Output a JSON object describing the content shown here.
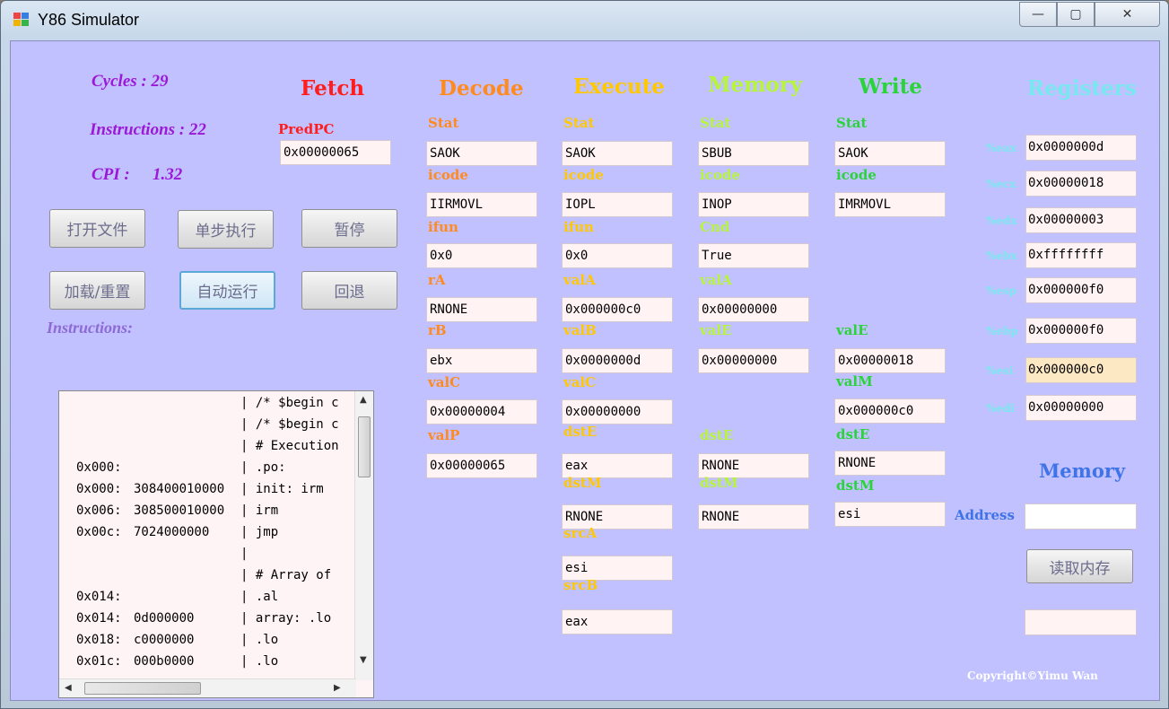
{
  "window": {
    "title": "Y86 Simulator",
    "min_label": "—",
    "max_label": "▢",
    "close_label": "✕"
  },
  "stats": {
    "cycles": "Cycles : 29",
    "instructions": "Instructions : 22",
    "cpi_label": "CPI :",
    "cpi_value": "1.32"
  },
  "buttons": {
    "open_file": "打开文件",
    "step": "单步执行",
    "pause": "暂停",
    "load_reset": "加载/重置",
    "auto_run": "自动运行",
    "rollback": "回退",
    "read_mem": "读取内存"
  },
  "instructions_label": "Instructions:",
  "instructions": [
    {
      "addr": "",
      "code": "",
      "src": "| /* $begin c"
    },
    {
      "addr": "",
      "code": "",
      "src": "| /* $begin c"
    },
    {
      "addr": "",
      "code": "",
      "src": "| # Execution"
    },
    {
      "addr": "0x000:",
      "code": "",
      "src": "|          .po:"
    },
    {
      "addr": "0x000:",
      "code": "308400010000",
      "src": "| init:    irm"
    },
    {
      "addr": "0x006:",
      "code": "308500010000",
      "src": "|          irm"
    },
    {
      "addr": "0x00c:",
      "code": "7024000000",
      "src": "|          jmp"
    },
    {
      "addr": "",
      "code": "",
      "src": "|"
    },
    {
      "addr": "",
      "code": "",
      "src": "| # Array of"
    },
    {
      "addr": "0x014:",
      "code": "",
      "src": "|          .al"
    },
    {
      "addr": "0x014:",
      "code": "0d000000",
      "src": "| array:   .lo"
    },
    {
      "addr": "0x018:",
      "code": "c0000000",
      "src": "|          .lo"
    },
    {
      "addr": "0x01c:",
      "code": "000b0000",
      "src": "|          .lo"
    }
  ],
  "fetch": {
    "header": "Fetch",
    "predpc_label": "PredPC",
    "predpc": "0x00000065"
  },
  "decode": {
    "header": "Decode",
    "labels": [
      "Stat",
      "icode",
      "ifun",
      "rA",
      "rB",
      "valC",
      "valP"
    ],
    "values": [
      "SAOK",
      "IIRMOVL",
      "0x0",
      "RNONE",
      "ebx",
      "0x00000004",
      "0x00000065"
    ]
  },
  "execute": {
    "header": "Execute",
    "labels": [
      "Stat",
      "icode",
      "ifun",
      "valA",
      "valB",
      "valC",
      "dstE",
      "dstM",
      "srcA",
      "srcB"
    ],
    "values": [
      "SAOK",
      "IOPL",
      "0x0",
      "0x000000c0",
      "0x0000000d",
      "0x00000000",
      "eax",
      "RNONE",
      "esi",
      "eax"
    ]
  },
  "memory": {
    "header": "Memory",
    "labels": [
      "Stat",
      "icode",
      "Cnd",
      "valA",
      "valE",
      "dstE",
      "dstM"
    ],
    "values": [
      "SBUB",
      "INOP",
      "True",
      "0x00000000",
      "0x00000000",
      "RNONE",
      "RNONE"
    ]
  },
  "write": {
    "header": "Write",
    "labels": [
      "Stat",
      "icode",
      "valE",
      "valM",
      "dstE",
      "dstM"
    ],
    "values": [
      "SAOK",
      "IMRMOVL",
      "0x00000018",
      "0x000000c0",
      "RNONE",
      "esi"
    ]
  },
  "registers": {
    "header": "Registers",
    "names": [
      "%eax",
      "%ecx",
      "%edx",
      "%ebx",
      "%esp",
      "%ebp",
      "%esi",
      "%edi"
    ],
    "values": [
      "0x0000000d",
      "0x00000018",
      "0x00000003",
      "0xffffffff",
      "0x000000f0",
      "0x000000f0",
      "0x000000c0",
      "0x00000000"
    ],
    "highlight_color": "#fde8c4"
  },
  "memory_panel": {
    "header": "Memory",
    "address_label": "Address",
    "address_value": "",
    "result_value": ""
  },
  "copyright": "Copyright©Yimu Wan",
  "colors": {
    "client_bg": "#c1c1ff",
    "fetch": "#ff1d1d",
    "decode": "#ff8a1e",
    "execute": "#ffc800",
    "memory": "#b6f53a",
    "write": "#2bd33a",
    "registers": "#79e8ee",
    "mem_panel": "#3f73e8"
  }
}
